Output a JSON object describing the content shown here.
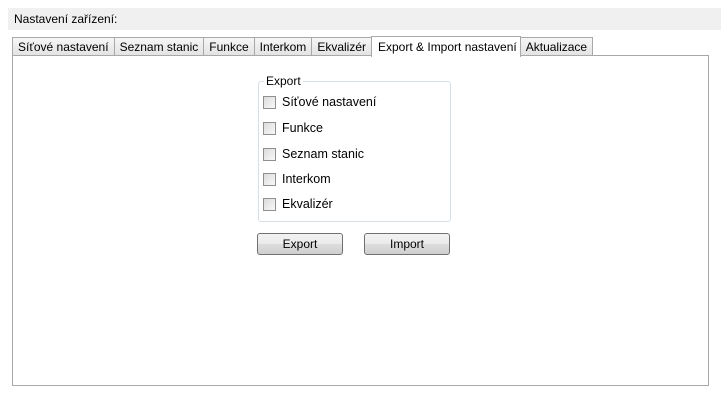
{
  "group": {
    "title": "Nastavení zařízení:"
  },
  "tabs": [
    {
      "label": "Síťové nastavení"
    },
    {
      "label": "Seznam stanic"
    },
    {
      "label": "Funkce"
    },
    {
      "label": "Interkom"
    },
    {
      "label": "Ekvalizér"
    },
    {
      "label": "Export & Import nastavení",
      "active": true
    },
    {
      "label": "Aktualizace"
    }
  ],
  "export_group": {
    "legend": "Export",
    "options": [
      {
        "label": "Síťové nastavení",
        "checked": false
      },
      {
        "label": "Funkce",
        "checked": false
      },
      {
        "label": "Seznam stanic",
        "checked": false
      },
      {
        "label": "Interkom",
        "checked": false
      },
      {
        "label": "Ekvalizér",
        "checked": false
      }
    ]
  },
  "buttons": {
    "export_label": "Export",
    "import_label": "Import"
  }
}
